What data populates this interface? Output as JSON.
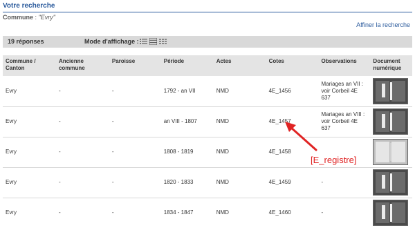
{
  "header": {
    "title": "Votre recherche"
  },
  "search": {
    "commune_label": "Commune",
    "commune_sep": " : ",
    "commune_value": "\"Evry\""
  },
  "refine_link": "Affiner la recherche",
  "results_bar": {
    "count": "19  réponses",
    "mode_label": "Mode d'affichage :",
    "view_icons": [
      "list-detail-icon",
      "list-icon",
      "grid-icon"
    ]
  },
  "table": {
    "headers": [
      "Commune / Canton",
      "Ancienne commune",
      "Paroisse",
      "Période",
      "Actes",
      "Cotes",
      "Observations",
      "Document numérique"
    ],
    "rows": [
      {
        "commune": "Evry",
        "ancienne": "-",
        "paroisse": "-",
        "periode": "1792 - an VII",
        "actes": "NMD",
        "cote": "4E_1456",
        "obs": "Mariages an VII : voir Corbeil 4E 637"
      },
      {
        "commune": "Evry",
        "ancienne": "-",
        "paroisse": "-",
        "periode": "an VIII - 1807",
        "actes": "NMD",
        "cote": "4E_1457",
        "obs": "Mariages an VIII : voir Corbeil 4E 637"
      },
      {
        "commune": "Evry",
        "ancienne": "-",
        "paroisse": "-",
        "periode": "1808 - 1819",
        "actes": "NMD",
        "cote": "4E_1458",
        "obs": ""
      },
      {
        "commune": "Evry",
        "ancienne": "-",
        "paroisse": "-",
        "periode": "1820 - 1833",
        "actes": "NMD",
        "cote": "4E_1459",
        "obs": "-"
      },
      {
        "commune": "Evry",
        "ancienne": "-",
        "paroisse": "-",
        "periode": "1834 - 1847",
        "actes": "NMD",
        "cote": "4E_1460",
        "obs": "-"
      }
    ]
  },
  "annotation": {
    "label": "[E_registre]",
    "color": "#e02424"
  },
  "colors": {
    "accent": "#2a5a9c",
    "bar": "#d9d9d9",
    "header_bg": "#e4e4e4"
  }
}
